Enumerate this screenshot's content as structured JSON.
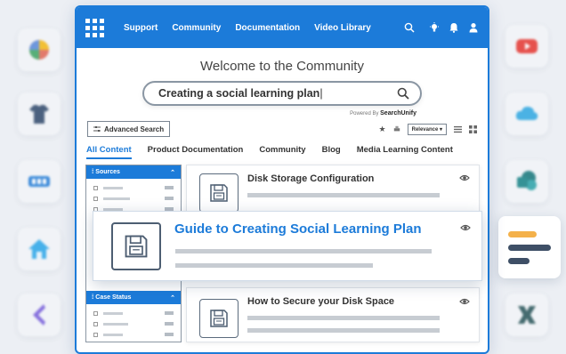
{
  "nav": {
    "links": [
      "Support",
      "Community",
      "Documentation",
      "Video Library"
    ],
    "icons": [
      "search-icon",
      "lightbulb-icon",
      "bell-icon",
      "user-icon"
    ]
  },
  "page": {
    "title": "Welcome to the Community",
    "search_value": "Creating a social learning plan",
    "powered_by_prefix": "Powered By",
    "powered_by_brand": "SearchUnify"
  },
  "toolbar": {
    "advanced_search_label": "Advanced Search",
    "sort_label": "Relevance"
  },
  "tabs": [
    "All Content",
    "Product Documentation",
    "Community",
    "Blog",
    "Media Learning Content"
  ],
  "sidebar": {
    "sections": [
      {
        "label": "Sources"
      },
      {
        "label": "Case Status"
      }
    ]
  },
  "results": [
    {
      "title": "Disk Storage Configuration"
    },
    {
      "title": "Guide to Creating Social Learning Plan",
      "featured": true
    },
    {
      "title": "How to Secure your Disk Space"
    }
  ],
  "colors": {
    "accent": "#1c7bd9",
    "title_text": "#444444"
  }
}
